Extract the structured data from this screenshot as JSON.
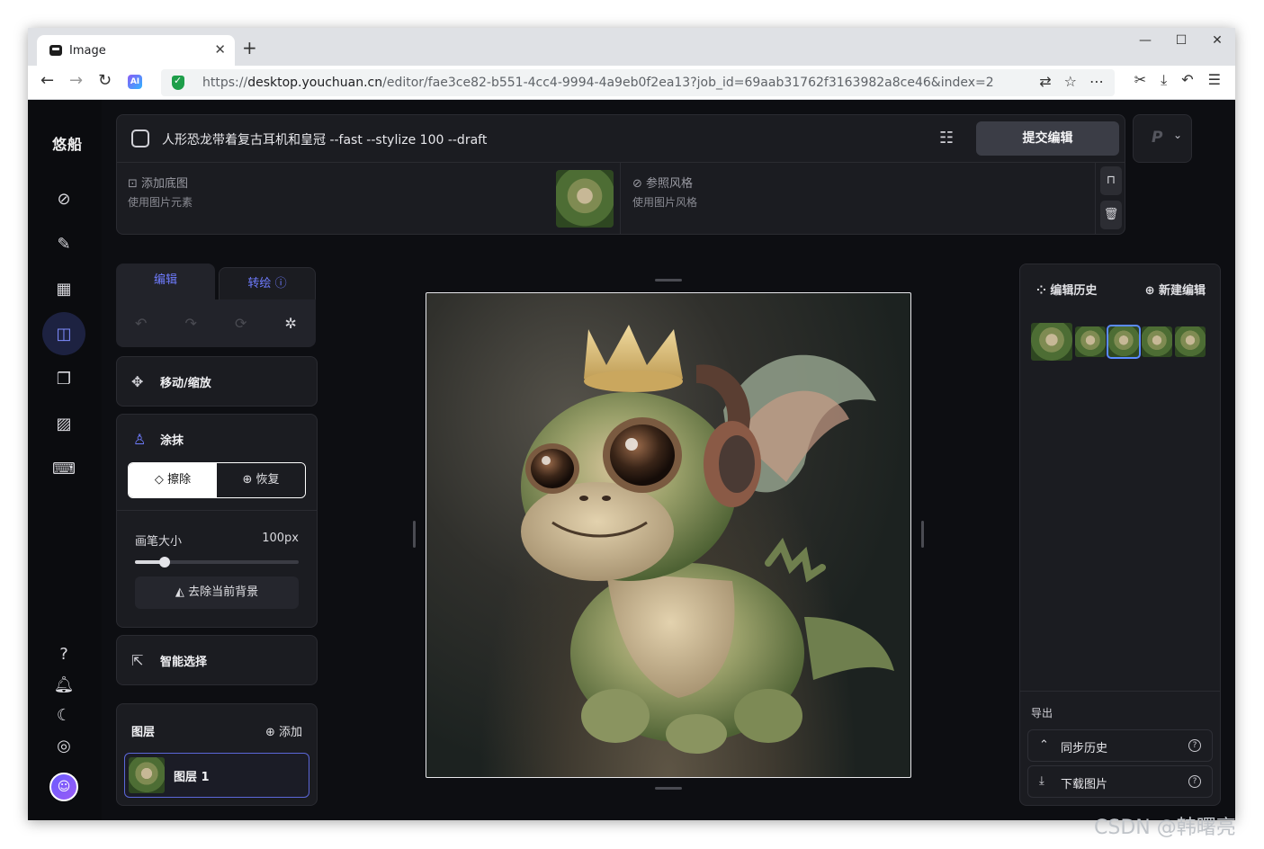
{
  "browser": {
    "tab_title": "Image",
    "url_scheme": "https://",
    "url_host": "desktop.youchuan.cn",
    "url_path": "/editor/fae3ce82-b551-4cc4-9994-4a9eb0f2ea13?job_id=69aab31762f3163982a8ce46&index=2",
    "ai_ext_label": "AI"
  },
  "app": {
    "logo": "悠船",
    "prompt": "人形恐龙带着复古耳机和皇冠 --fast --stylize 100 --draft",
    "submit_label": "提交编辑",
    "model_initial": "P",
    "base_image": {
      "title": "添加底图",
      "subtitle": "使用图片元素"
    },
    "style_ref": {
      "title": "参照风格",
      "subtitle": "使用图片风格"
    }
  },
  "tools": {
    "tab_edit": "编辑",
    "tab_redraw": "转绘",
    "move_scale": "移动/缩放",
    "paint": "涂抹",
    "erase": "擦除",
    "restore": "恢复",
    "brush_label": "画笔大小",
    "brush_value": "100px",
    "brush_level": 0.18,
    "remove_bg": "去除当前背景",
    "smart_select": "智能选择"
  },
  "layers": {
    "title": "图层",
    "add_label": "添加",
    "items": [
      {
        "name": "图层 1"
      }
    ]
  },
  "history": {
    "title": "编辑历史",
    "new_edit": "新建编辑",
    "selected_index": 2,
    "count": 5
  },
  "export": {
    "title": "导出",
    "sync_history": "同步历史",
    "download": "下载图片"
  },
  "watermark": "CSDN @韩曙亮",
  "colors": {
    "accent": "#6f7cff",
    "background": "#0d0e12",
    "panel": "#1b1c21"
  }
}
